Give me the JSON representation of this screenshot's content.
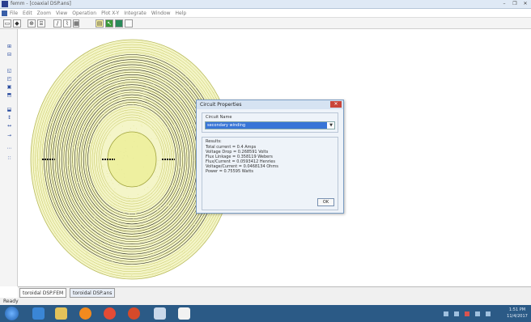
{
  "window": {
    "title": "femm - [coaxial DSP.ans]",
    "controls": [
      "–",
      "❐",
      "✕"
    ]
  },
  "menu": [
    "File",
    "Edit",
    "Zoom",
    "View",
    "Operation",
    "Plot X-Y",
    "Integrate",
    "Window",
    "Help"
  ],
  "toolbar": {
    "buttons": [
      "▭",
      "◆",
      "⊕",
      "⌸",
      "∕",
      "⌇",
      "▦",
      "▤",
      "↖"
    ]
  },
  "lefttoolbar": {
    "buttons": [
      "⊞",
      "⊟",
      "◱",
      "◰",
      "▣",
      "⬒",
      "⬓",
      "↕",
      "↔",
      "→",
      "⋯",
      "∷"
    ]
  },
  "tabs": [
    "toroidal DSP.FEM",
    "toroidal DSP.ans"
  ],
  "status": "Ready",
  "dialog": {
    "title": "Circuit Properties",
    "circuit_label": "Circuit Name",
    "circuit_value": "secondary winding",
    "results_label": "Results:",
    "results": [
      "Total current = 0.4 Amps",
      "Voltage Drop = 0.268591 Volts",
      "Flux Linkage = 0.358119 Webers",
      "Flux/Current = 0.0593412 Henries",
      "Voltage/Current = 0.0468134 Ohms",
      "Power = 0.75595 Watts"
    ],
    "ok_label": "OK"
  },
  "taskbar": {
    "clock_time": "1:51 PM",
    "clock_date": "11/4/2017"
  },
  "colors": {
    "mesh": "#e6e89a",
    "winding": "#2a2a2a",
    "taskbar": "#2b5a86",
    "selection": "#3875d7"
  }
}
